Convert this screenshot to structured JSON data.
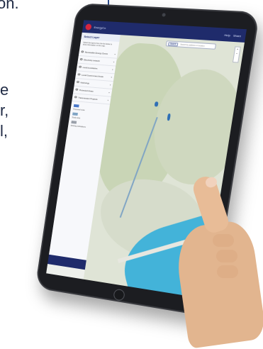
{
  "background_text": {
    "line1": "on.",
    "line2": "e",
    "line3": "r,",
    "line4": "l,"
  },
  "app": {
    "title": "EnergyCo",
    "header_right": [
      "Help",
      "Share"
    ],
    "search_button_label": "Search",
    "search_placeholder": "Search by address or location"
  },
  "sidebar": {
    "title": "Select Layer",
    "intro": "Select the layers from the list below to show information on the map.",
    "items": [
      {
        "label": "Renewable Energy Zones"
      },
      {
        "label": "Electricity network"
      },
      {
        "label": "Land boundaries"
      },
      {
        "label": "Local Government Areas"
      },
      {
        "label": "Hydrology"
      },
      {
        "label": "Protected Areas"
      },
      {
        "label": "Transmission Projects"
      }
    ],
    "legend": [
      {
        "label": "Proposed route",
        "color": "#4a78c8"
      },
      {
        "label": "Study area",
        "color": "#7fa4c4"
      },
      {
        "label": "Existing substations",
        "color": "#9aa0aa"
      }
    ]
  },
  "map": {
    "zoom_in": "+",
    "zoom_out": "−"
  },
  "colors": {
    "header": "#1f2b6b",
    "sea": "#43b3d9",
    "tablet_frame": "#1c1d21"
  }
}
